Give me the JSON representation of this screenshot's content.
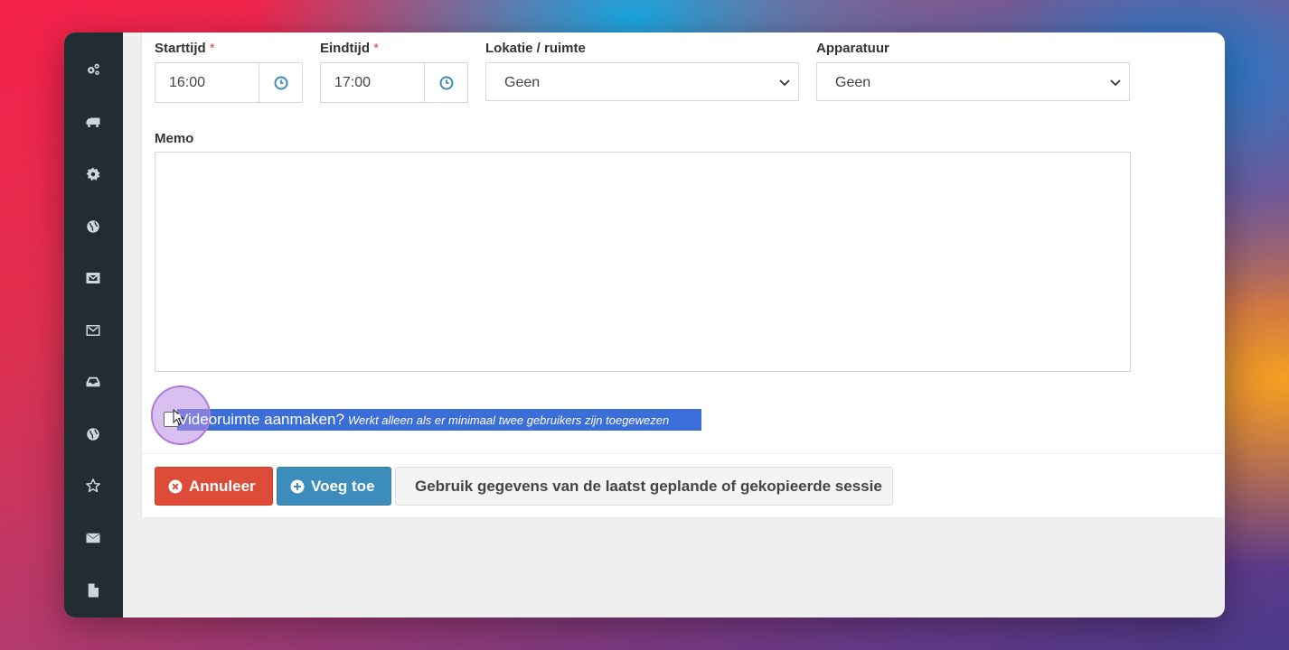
{
  "form": {
    "start_time": {
      "label": "Starttijd",
      "required_mark": "*",
      "value": "16:00"
    },
    "end_time": {
      "label": "Eindtijd",
      "required_mark": "*",
      "value": "17:00"
    },
    "location": {
      "label": "Lokatie / ruimte",
      "selected": "Geen"
    },
    "equipment": {
      "label": "Apparatuur",
      "selected": "Geen"
    },
    "memo": {
      "label": "Memo",
      "value": ""
    },
    "video_room": {
      "label": "Videoruimte aanmaken?",
      "hint": "Werkt alleen als er minimaal twee gebruikers zijn toegewezen",
      "checked": false
    }
  },
  "buttons": {
    "cancel": "Annuleer",
    "add": "Voeg toe",
    "use_previous": "Gebruik gegevens van de laatst geplande of gekopieerde sessie"
  },
  "sidebar": {
    "icons": [
      "gears-icon",
      "truck-icon",
      "gear-icon",
      "globe-icon",
      "envelope-outline-icon",
      "envelope-outline-icon",
      "inbox-icon",
      "globe-icon",
      "star-outline-icon",
      "envelope-icon",
      "file-icon"
    ]
  },
  "colors": {
    "sidebar_bg": "#222d32",
    "danger": "#dd4b39",
    "primary": "#3c8dbc",
    "required": "#dd4b39",
    "selection": "#3b6ed8"
  }
}
